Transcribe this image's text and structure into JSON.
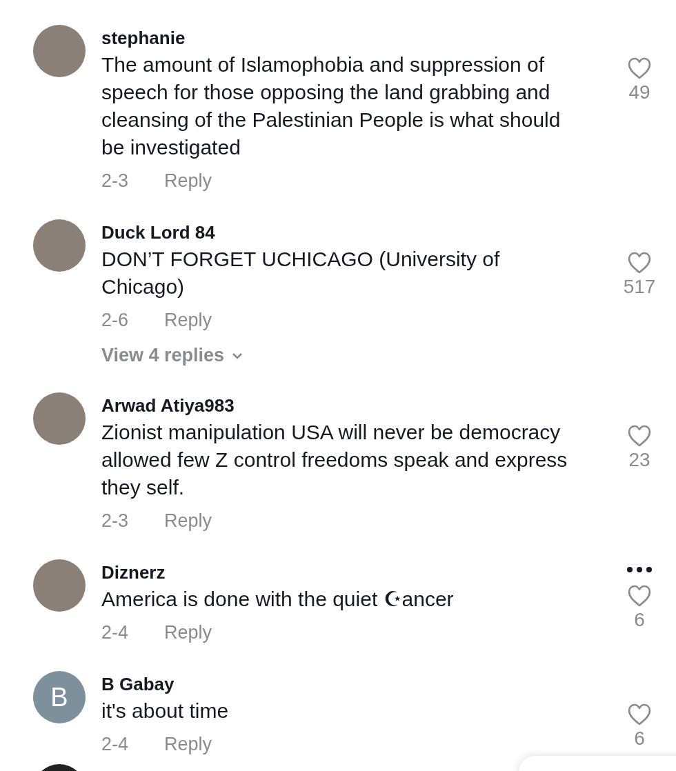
{
  "comments": [
    {
      "avatar": {
        "kind": "photo"
      },
      "username": "stephanie",
      "text": "The amount of Islamophobia and suppression of speech for those opposing the land grabbing and cleansing of the Palestinian People is what should be investigated",
      "date": "2-3",
      "reply": "Reply",
      "likes": "49",
      "more_menu": false
    },
    {
      "avatar": {
        "kind": "photo"
      },
      "username": "Duck Lord 84",
      "text": "DON’T FORGET UCHICAGO (University of Chicago)",
      "date": "2-6",
      "reply": "Reply",
      "likes": "517",
      "more_menu": false,
      "view_replies": "View 4 replies"
    },
    {
      "avatar": {
        "kind": "photo"
      },
      "username": "Arwad Atiya983",
      "text": "Zionist manipulation USA will never be democracy allowed few Z control freedoms speak and express they self.",
      "date": "2-3",
      "reply": "Reply",
      "likes": "23",
      "more_menu": false
    },
    {
      "avatar": {
        "kind": "photo"
      },
      "username": "Diznerz",
      "text": "America is done with the quiet ☪ancer",
      "date": "2-4",
      "reply": "Reply",
      "likes": "6",
      "more_menu": true
    },
    {
      "avatar": {
        "kind": "letter",
        "letter": "B"
      },
      "username": "B Gabay",
      "text": "it's about time",
      "date": "2-4",
      "reply": "Reply",
      "likes": "6",
      "more_menu": false
    }
  ]
}
